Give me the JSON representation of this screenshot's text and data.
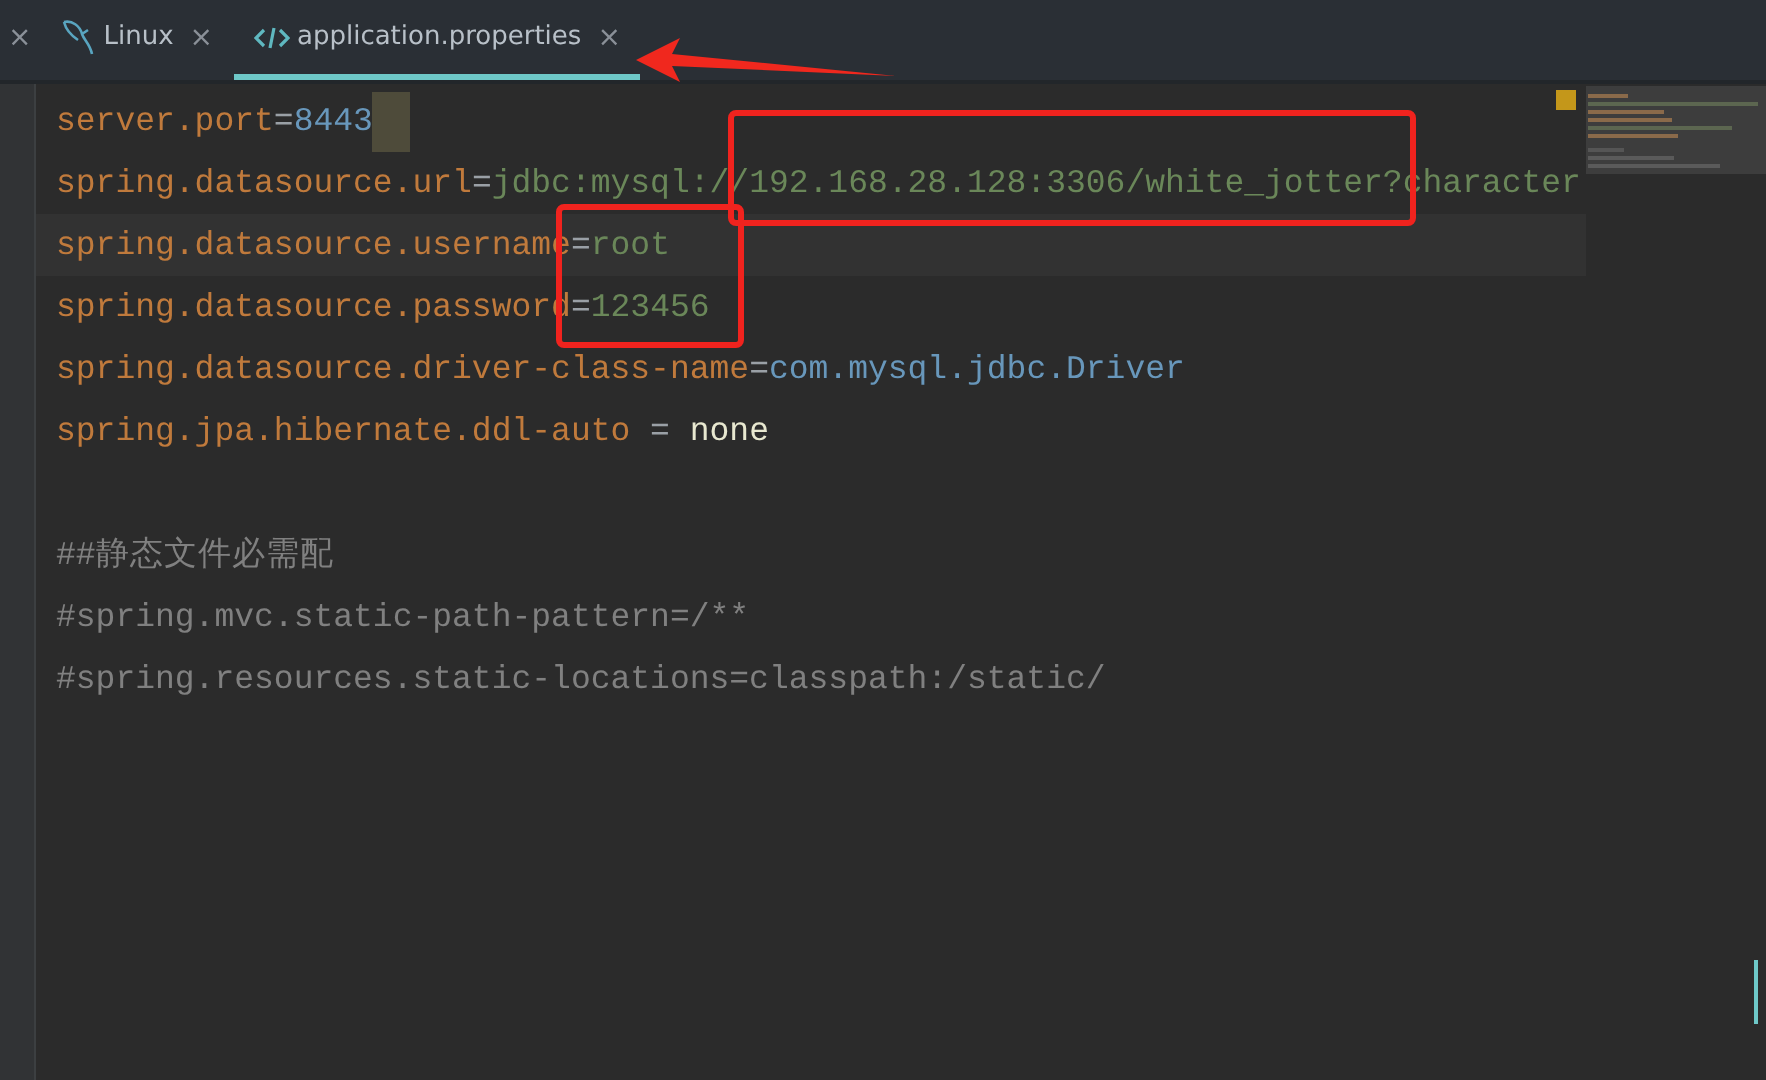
{
  "tabs": [
    {
      "kind": "partial",
      "close": "×",
      "selected": false
    },
    {
      "kind": "database",
      "label": "Linux",
      "close": "×",
      "selected": false
    },
    {
      "kind": "source",
      "label": "application.properties",
      "close": "×",
      "selected": true
    }
  ],
  "editor": {
    "lines": [
      {
        "current": false,
        "caret": true,
        "tokens": [
          {
            "kind": "key",
            "text": "server.port"
          },
          {
            "kind": "op",
            "text": "="
          },
          {
            "kind": "number",
            "text": "8443"
          }
        ]
      },
      {
        "current": false,
        "caret": false,
        "tokens": [
          {
            "kind": "key",
            "text": "spring.datasource.url"
          },
          {
            "kind": "op",
            "text": "="
          },
          {
            "kind": "string",
            "text": "jdbc:mysql://192.168.28.128:3306/white_jotter?character"
          }
        ]
      },
      {
        "current": true,
        "caret": false,
        "tokens": [
          {
            "kind": "key",
            "text": "spring.datasource.username"
          },
          {
            "kind": "op",
            "text": "="
          },
          {
            "kind": "string",
            "text": "root"
          }
        ]
      },
      {
        "current": false,
        "caret": false,
        "tokens": [
          {
            "kind": "key",
            "text": "spring.datasource.password"
          },
          {
            "kind": "op",
            "text": "="
          },
          {
            "kind": "string",
            "text": "123456"
          }
        ]
      },
      {
        "current": false,
        "caret": false,
        "tokens": [
          {
            "kind": "key",
            "text": "spring.datasource.driver-class-name"
          },
          {
            "kind": "op",
            "text": "="
          },
          {
            "kind": "number",
            "text": "com.mysql.jdbc.Driver"
          }
        ]
      },
      {
        "current": false,
        "caret": false,
        "tokens": [
          {
            "kind": "key",
            "text": "spring.jpa.hibernate.ddl-auto"
          },
          {
            "kind": "op",
            "text": " = "
          },
          {
            "kind": "plain",
            "text": "none"
          }
        ]
      },
      {
        "current": false,
        "caret": false
      },
      {
        "current": false,
        "caret": false,
        "tokens": [
          {
            "kind": "comment",
            "text": "##静态文件必需配"
          }
        ]
      },
      {
        "current": false,
        "caret": false,
        "tokens": [
          {
            "kind": "comment",
            "text": "#spring.mvc.static-path-pattern=/**"
          }
        ]
      },
      {
        "current": false,
        "caret": false,
        "tokens": [
          {
            "kind": "comment",
            "text": "#spring.resources.static-locations=classpath:/static/"
          }
        ]
      }
    ]
  }
}
